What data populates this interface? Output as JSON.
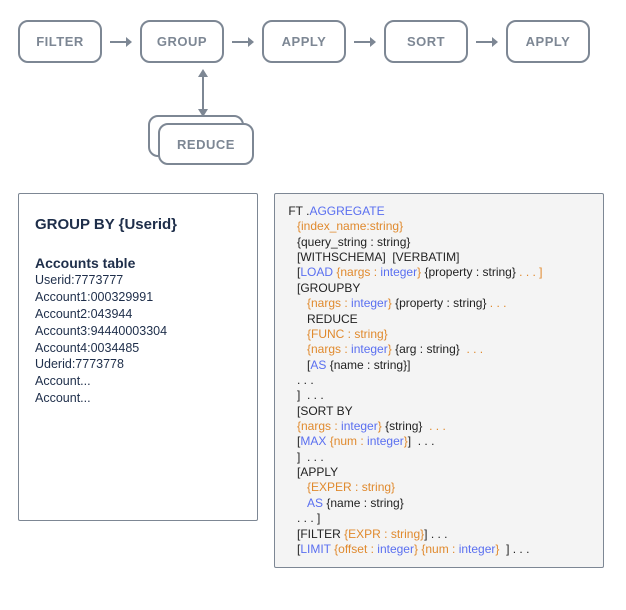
{
  "flow": {
    "filter": "FILTER",
    "group": "GROUP",
    "apply1": "APPLY",
    "sort": "SORT",
    "apply2": "APPLY",
    "reduce": "REDUCE"
  },
  "left": {
    "title": "GROUP BY {Userid}",
    "table_title": "Accounts table",
    "rows": [
      "Userid:7773777",
      "Account1:000329991",
      "Account2:043944",
      "Account3:94440003304",
      "Account4:0034485",
      "Uderid:7773778",
      "Account...",
      "Account..."
    ]
  },
  "code": {
    "l1_a": "FT .",
    "l1_b": "AGGREGATE",
    "l2": "{index_name:string}",
    "l3": "{query_string : string}",
    "l4": "[WITHSCHEMA]  [VERBATIM]",
    "l5_a": "[",
    "l5_b": "LOAD",
    "l5_c": " {nargs : ",
    "l5_d": "integer",
    "l5_e": "}",
    "l5_f": " {property : string}",
    "l5_g": " . . . ]",
    "l6": "[GROUPBY",
    "l7_a": "{nargs : ",
    "l7_b": "integer",
    "l7_c": "}",
    "l7_d": " {property : string}",
    "l7_e": " . . .",
    "l8": "REDUCE",
    "l9": "{FUNC : string}",
    "l10_a": "{nargs : ",
    "l10_b": "integer",
    "l10_c": "}",
    "l10_d": " {arg : string}",
    "l10_e": "  . . .",
    "l11_a": "[",
    "l11_b": "AS",
    "l11_c": " {name : string}",
    "l11_d": "]",
    "l12": ". . .",
    "l13": "]  . . .",
    "l14": "[SORT BY",
    "l15_a": "{nargs : ",
    "l15_b": "integer",
    "l15_c": "}",
    "l15_d": " {string}",
    "l15_e": "  . . .",
    "l16_a": "[",
    "l16_b": "MAX",
    "l16_c": " {num : ",
    "l16_d": "integer",
    "l16_e": "}",
    "l16_f": "]  . . .",
    "l17": "]  . . .",
    "l18": "[APPLY",
    "l19": "{EXPER : string}",
    "l20_a": "AS",
    "l20_b": " {name : string}",
    "l21": ". . . ]",
    "l22_a": "[FILTER ",
    "l22_b": "{EXPR : string}",
    "l22_c": "] . . .",
    "l23_a": "[",
    "l23_b": "LIMIT",
    "l23_c": " {offset : ",
    "l23_d": "integer",
    "l23_e": "}",
    "l23_f": " {num : ",
    "l23_g": "integer",
    "l23_h": "}",
    "l23_i": "  ] . . ."
  }
}
